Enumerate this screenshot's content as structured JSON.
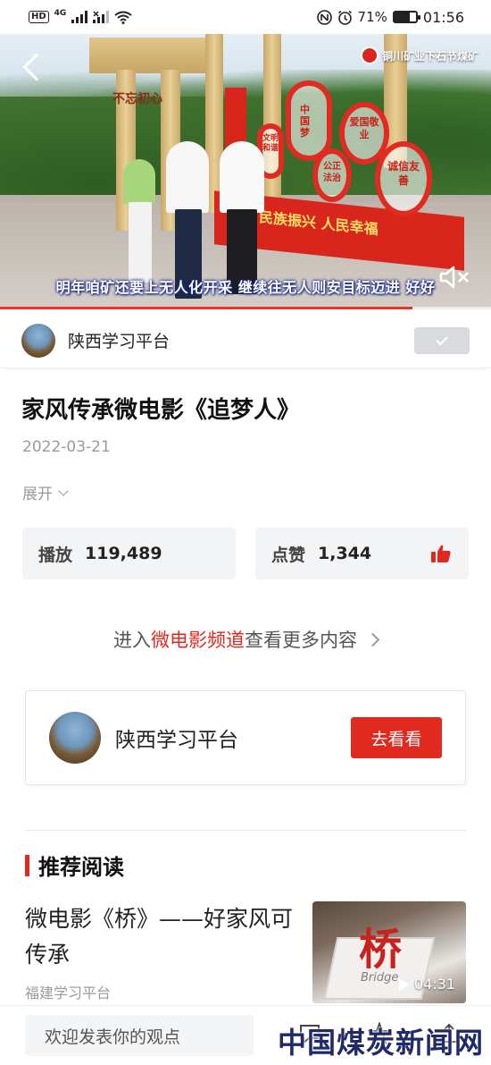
{
  "status_bar": {
    "hd": "HD",
    "network": "4G",
    "battery": "71%",
    "battery_level": 0.71,
    "time": "01:56"
  },
  "video": {
    "logo_text": "铜川矿业下石节煤矿",
    "subtitle": "明年咱矿还要上无人化开采   继续往无人则安目标迈进  好好",
    "progress": 0.84,
    "scene_texts": [
      "不忘初心",
      "中国梦",
      "爱国敬业",
      "诚信友善",
      "公正法治",
      "文明和谐",
      "民族振兴 人民幸福"
    ]
  },
  "channel": {
    "name": "陕西学习平台"
  },
  "article": {
    "title": "家风传承微电影《追梦人》",
    "date": "2022-03-21",
    "expand_label": "展开"
  },
  "stats": {
    "plays_label": "播放",
    "plays_value": "119,489",
    "likes_label": "点赞",
    "likes_value": "1,344"
  },
  "channel_link": {
    "prefix": "进入",
    "highlight": "微电影频道",
    "suffix": "查看更多内容"
  },
  "promo": {
    "name": "陕西学习平台",
    "button": "去看看"
  },
  "recommend": {
    "heading": "推荐阅读",
    "items": [
      {
        "title": "微电影《桥》——好家风可传承",
        "source": "福建学习平台",
        "thumb_char": "桥",
        "thumb_sub": "Bridge",
        "duration": "04:31"
      }
    ]
  },
  "bottom_bar": {
    "comment_placeholder": "欢迎发表你的观点",
    "watermark": "中国煤炭新闻网"
  },
  "colors": {
    "accent": "#e0291f",
    "stat_bg": "#f3f4f6",
    "muted": "#9a9a9a"
  }
}
